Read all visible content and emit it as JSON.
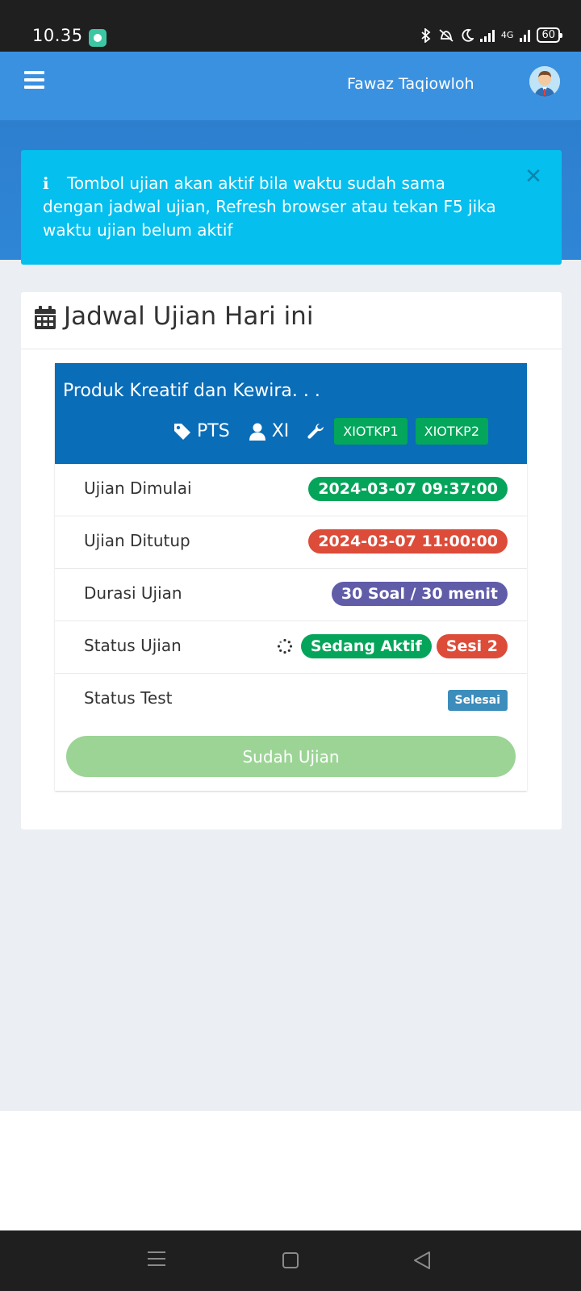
{
  "status_bar": {
    "time": "10.35",
    "network": "4G",
    "battery": "60"
  },
  "navbar": {
    "menu_icon": "hamburger-icon",
    "user_name": "Fawaz Taqiowloh",
    "avatar_icon": "user-avatar"
  },
  "alert": {
    "icon": "info-icon",
    "info_glyph": "i",
    "message": "Tombol ujian akan aktif bila waktu sudah sama dengan jadwal ujian, Refresh browser atau tekan F5 jika waktu ujian belum aktif",
    "close_glyph": "✕"
  },
  "schedule": {
    "title": "Jadwal Ujian Hari ini",
    "icon": "calendar-icon"
  },
  "exam": {
    "subject": "Produk Kreatif dan Kewira. . .",
    "type": "PTS",
    "class": "XI",
    "rooms": [
      "XIOTKP1",
      "XIOTKP2"
    ],
    "rows": {
      "start": {
        "label": "Ujian Dimulai",
        "value": "2024-03-07 09:37:00"
      },
      "end": {
        "label": "Ujian Ditutup",
        "value": "2024-03-07 11:00:00"
      },
      "duration": {
        "label": "Durasi Ujian",
        "value": "30 Soal / 30 menit"
      },
      "status": {
        "label": "Status Ujian",
        "value": "Sedang Aktif",
        "session": "Sesi 2"
      },
      "test": {
        "label": "Status Test",
        "value": "Selesai"
      }
    },
    "button_label": "Sudah Ujian"
  },
  "colors": {
    "navbar": "#3a91e0",
    "alert": "#05bfee",
    "exam_header": "#0a6db8",
    "green": "#04a55a",
    "red": "#dd4b39",
    "purple": "#605ca8",
    "button_disabled": "#9cd496"
  }
}
